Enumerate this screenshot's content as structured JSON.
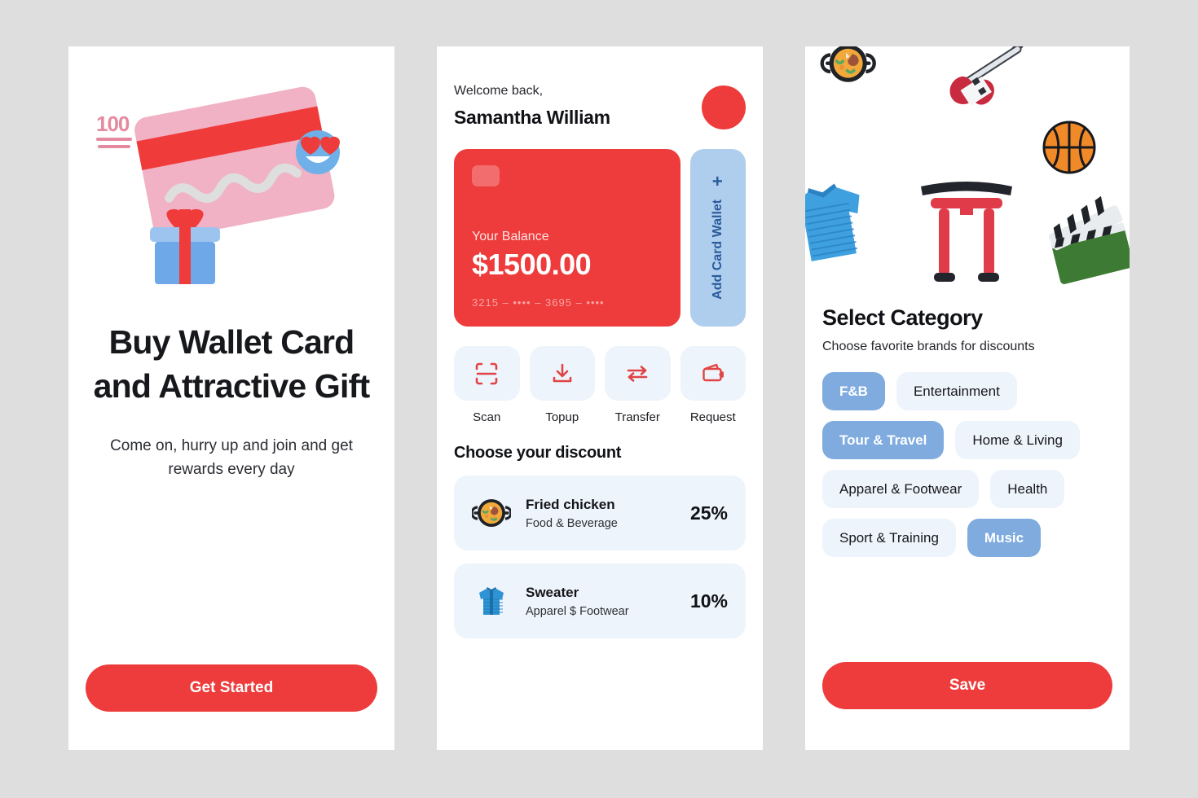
{
  "theme": {
    "page_background": "#dedede",
    "accent_red": "#ee3b3b",
    "chip_selected_blue": "#7fabdf",
    "tile_blue": "#eef4fc",
    "add_card_blue": "#afcdec"
  },
  "onboarding": {
    "art_icons": [
      "credit-card",
      "gift-box",
      "hundred-points",
      "heart-eyes-face"
    ],
    "headline": "Buy Wallet Card and Attractive Gift",
    "subcopy": "Come on, hurry up and join and get rewards every day",
    "cta_label": "Get Started"
  },
  "wallet": {
    "welcome_greeting": "Welcome back,",
    "user_name": "Samantha William",
    "avatar_icon": "avatar",
    "balance_card": {
      "chip_icon": "card-chip",
      "label": "Your Balance",
      "amount": "$1500.00",
      "number": "3215 – ••••  – 3695 – ••••"
    },
    "add_card": {
      "label": "Add Card Wallet",
      "plus": "+"
    },
    "actions": [
      {
        "label": "Scan",
        "icon": "scan-icon"
      },
      {
        "label": "Topup",
        "icon": "topup-icon"
      },
      {
        "label": "Transfer",
        "icon": "transfer-icon"
      },
      {
        "label": "Request",
        "icon": "request-wallet-icon"
      }
    ],
    "discount_section_title": "Choose your discount",
    "discounts": [
      {
        "name": "Fried chicken",
        "category": "Food & Beverage",
        "percent": "25%",
        "icon": "paella-pan"
      },
      {
        "name": "Sweater",
        "category": "Apparel $ Footwear",
        "percent": "10%",
        "icon": "blue-jacket"
      }
    ]
  },
  "category": {
    "art_icons": [
      "paella-pan",
      "electric-guitar",
      "basketball",
      "blue-sweater",
      "torii-gate",
      "clapper-board"
    ],
    "title": "Select Category",
    "subtitle": "Choose favorite brands for discounts",
    "chips": [
      {
        "label": "F&B",
        "selected": true
      },
      {
        "label": "Entertainment",
        "selected": false
      },
      {
        "label": "Tour & Travel",
        "selected": true
      },
      {
        "label": "Home & Living",
        "selected": false
      },
      {
        "label": "Apparel & Footwear",
        "selected": false
      },
      {
        "label": "Health",
        "selected": false
      },
      {
        "label": "Sport & Training",
        "selected": false
      },
      {
        "label": "Music",
        "selected": true
      }
    ],
    "save_label": "Save"
  }
}
